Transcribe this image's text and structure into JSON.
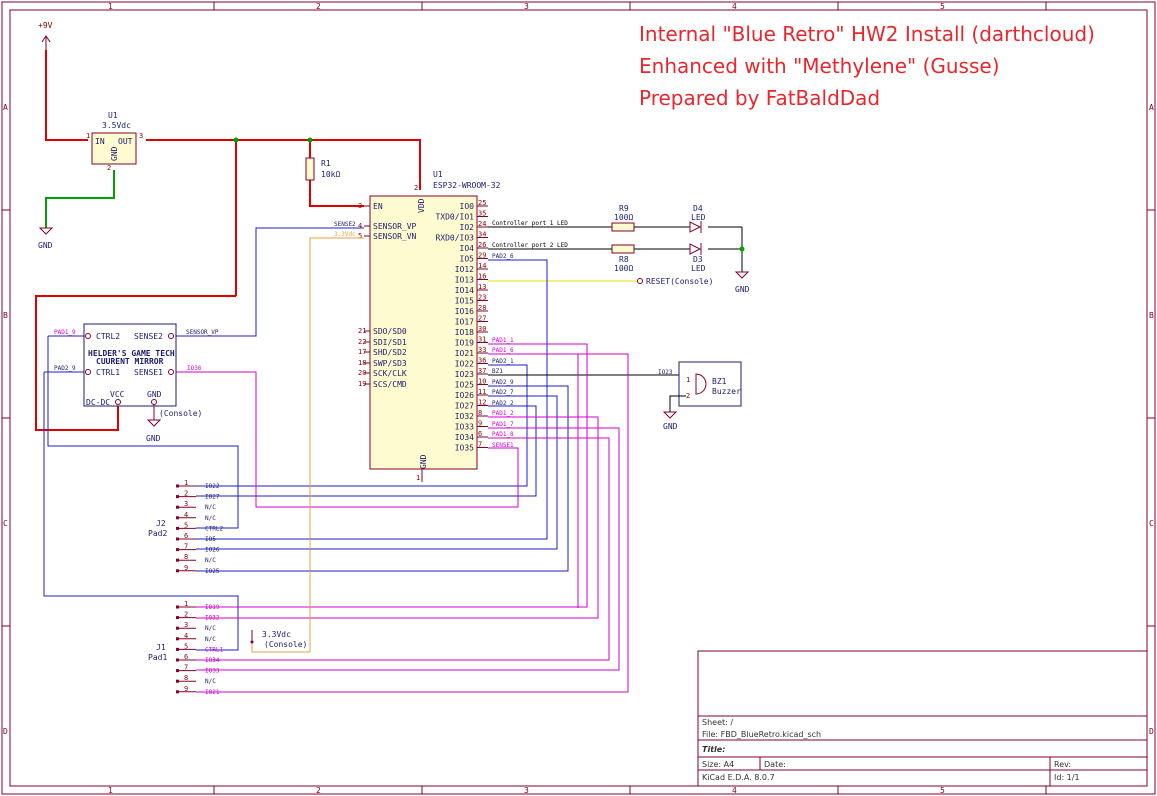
{
  "title_lines": [
    "Internal \"Blue Retro\" HW2 Install (darthcloud)",
    "Enhanced with \"Methylene\" (Gusse)",
    "Prepared by FatBaldDad"
  ],
  "border": {
    "columns": [
      "1",
      "2",
      "3",
      "4",
      "5"
    ],
    "rows": [
      "A",
      "B",
      "C",
      "D"
    ]
  },
  "power": {
    "plus9v": "+9V",
    "gnd": "GND",
    "v33_label": "3.3Vdc",
    "v33_sub": "(Console)",
    "console_sub": "(Console)"
  },
  "regulator": {
    "ref": "U1",
    "value": "3.5Vdc",
    "pin_in": "IN",
    "pin_out": "OUT",
    "pin_gnd": "GND",
    "pin1": "1",
    "pin2": "2",
    "pin3": "3"
  },
  "resistors": {
    "r1_ref": "R1",
    "r1_val": "10kΩ",
    "r9_ref": "R9",
    "r9_val": "100Ω",
    "r8_ref": "R8",
    "r8_val": "100Ω"
  },
  "leds": {
    "d4_ref": "D4",
    "d4_val": "LED",
    "d3_ref": "D3",
    "d3_val": "LED"
  },
  "esp32": {
    "ref": "U1",
    "value": "ESP32-WROOM-32",
    "left_pins": [
      {
        "num": "3",
        "name": "EN"
      },
      {
        "num": "4",
        "name": "SENSOR_VP"
      },
      {
        "num": "5",
        "name": "SENSOR_VN"
      },
      {
        "num": "21",
        "name": "SDO/SD0"
      },
      {
        "num": "22",
        "name": "SDI/SD1"
      },
      {
        "num": "17",
        "name": "SHD/SD2"
      },
      {
        "num": "18",
        "name": "SWP/SD3"
      },
      {
        "num": "20",
        "name": "SCK/CLK"
      },
      {
        "num": "19",
        "name": "SCS/CMD"
      }
    ],
    "right_pins": [
      {
        "num": "25",
        "name": "IO0"
      },
      {
        "num": "35",
        "name": "TXD0/IO1"
      },
      {
        "num": "24",
        "name": "IO2"
      },
      {
        "num": "34",
        "name": "RXD0/IO3"
      },
      {
        "num": "26",
        "name": "IO4"
      },
      {
        "num": "29",
        "name": "IO5"
      },
      {
        "num": "14",
        "name": "IO12"
      },
      {
        "num": "16",
        "name": "IO13"
      },
      {
        "num": "13",
        "name": "IO14"
      },
      {
        "num": "23",
        "name": "IO15"
      },
      {
        "num": "28",
        "name": "IO16"
      },
      {
        "num": "27",
        "name": "IO17"
      },
      {
        "num": "30",
        "name": "IO18"
      },
      {
        "num": "31",
        "name": "IO19"
      },
      {
        "num": "33",
        "name": "IO21"
      },
      {
        "num": "36",
        "name": "IO22"
      },
      {
        "num": "37",
        "name": "IO23"
      },
      {
        "num": "10",
        "name": "IO25"
      },
      {
        "num": "11",
        "name": "IO26"
      },
      {
        "num": "12",
        "name": "IO27"
      },
      {
        "num": "8",
        "name": "IO32"
      },
      {
        "num": "9",
        "name": "IO33"
      },
      {
        "num": "6",
        "name": "IO34"
      },
      {
        "num": "7",
        "name": "IO35"
      }
    ],
    "vdd": "VDD",
    "vdd_num": "2",
    "gnd": "GND",
    "gnd_num": "1"
  },
  "nets": {
    "sense2": "SENSE2",
    "v33dc": "3.3Vdc",
    "ctrl_p1": "Controller port 1 LED",
    "ctrl_p2": "Controller port 2 LED",
    "pad2_6": "PAD2_6",
    "reset": "RESET(Console)",
    "pad1_1": "PAD1_1",
    "pad1_6": "PAD1_6",
    "pad2_1": "PAD2_1",
    "bz1": "BZ1",
    "pad2_9": "PAD2_9",
    "pad2_7": "PAD2_7",
    "pad2_2": "PAD2_2",
    "pad1_2": "PAD1_2",
    "pad1_7": "PAD1_7",
    "pad1_8": "PAD1_8",
    "sense1": "SENSE1",
    "pad1_9": "PAD1_9",
    "pad2_9b": "PAD2_9",
    "sensor_vp": "SENSOR_VP",
    "io36": "IO36",
    "io23": "IO23"
  },
  "mirror": {
    "ctrl2": "CTRL2",
    "sense2": "SENSE2",
    "name1": "HELDER'S GAME TECH",
    "name2": "CUURENT MIRROR",
    "ctrl1": "CTRL1",
    "sense1": "SENSE1",
    "vcc": "VCC",
    "dcdc": "DC-DC",
    "gnd": "GND"
  },
  "buzzer": {
    "ref": "BZ1",
    "value": "Buzzer",
    "pin1": "1",
    "pin2": "2"
  },
  "j2": {
    "ref": "J2",
    "value": "Pad2",
    "pins": [
      "1",
      "2",
      "3",
      "4",
      "5",
      "6",
      "7",
      "8",
      "9"
    ],
    "labels": [
      "IO22",
      "IO27",
      "N/C",
      "N/C",
      "CTRL2",
      "IO5",
      "IO26",
      "N/C",
      "IO25"
    ]
  },
  "j1": {
    "ref": "J1",
    "value": "Pad1",
    "pins": [
      "1",
      "2",
      "3",
      "4",
      "5",
      "6",
      "7",
      "8",
      "9"
    ],
    "labels": [
      "IO19",
      "IO32",
      "N/C",
      "N/C",
      "CTRL1",
      "IO34",
      "IO33",
      "N/C",
      "IO21"
    ]
  },
  "title_block": {
    "sheet": "Sheet: /",
    "file": "File: FBD_BlueRetro.kicad_sch",
    "title": "Title:",
    "size": "Size: A4",
    "date": "Date:",
    "rev": "Rev:",
    "tool": "KiCad E.D.A. 8.0.7",
    "id": "Id: 1/1"
  },
  "colors": {
    "border": "#84002a",
    "wire_blue": "#1c1cc8",
    "wire_red": "#e00000",
    "wire_green": "#00a000",
    "wire_magenta": "#d200d2",
    "wire_orange": "#e8a040",
    "wire_yellow": "#e8e000",
    "title_red": "#e8272c"
  }
}
